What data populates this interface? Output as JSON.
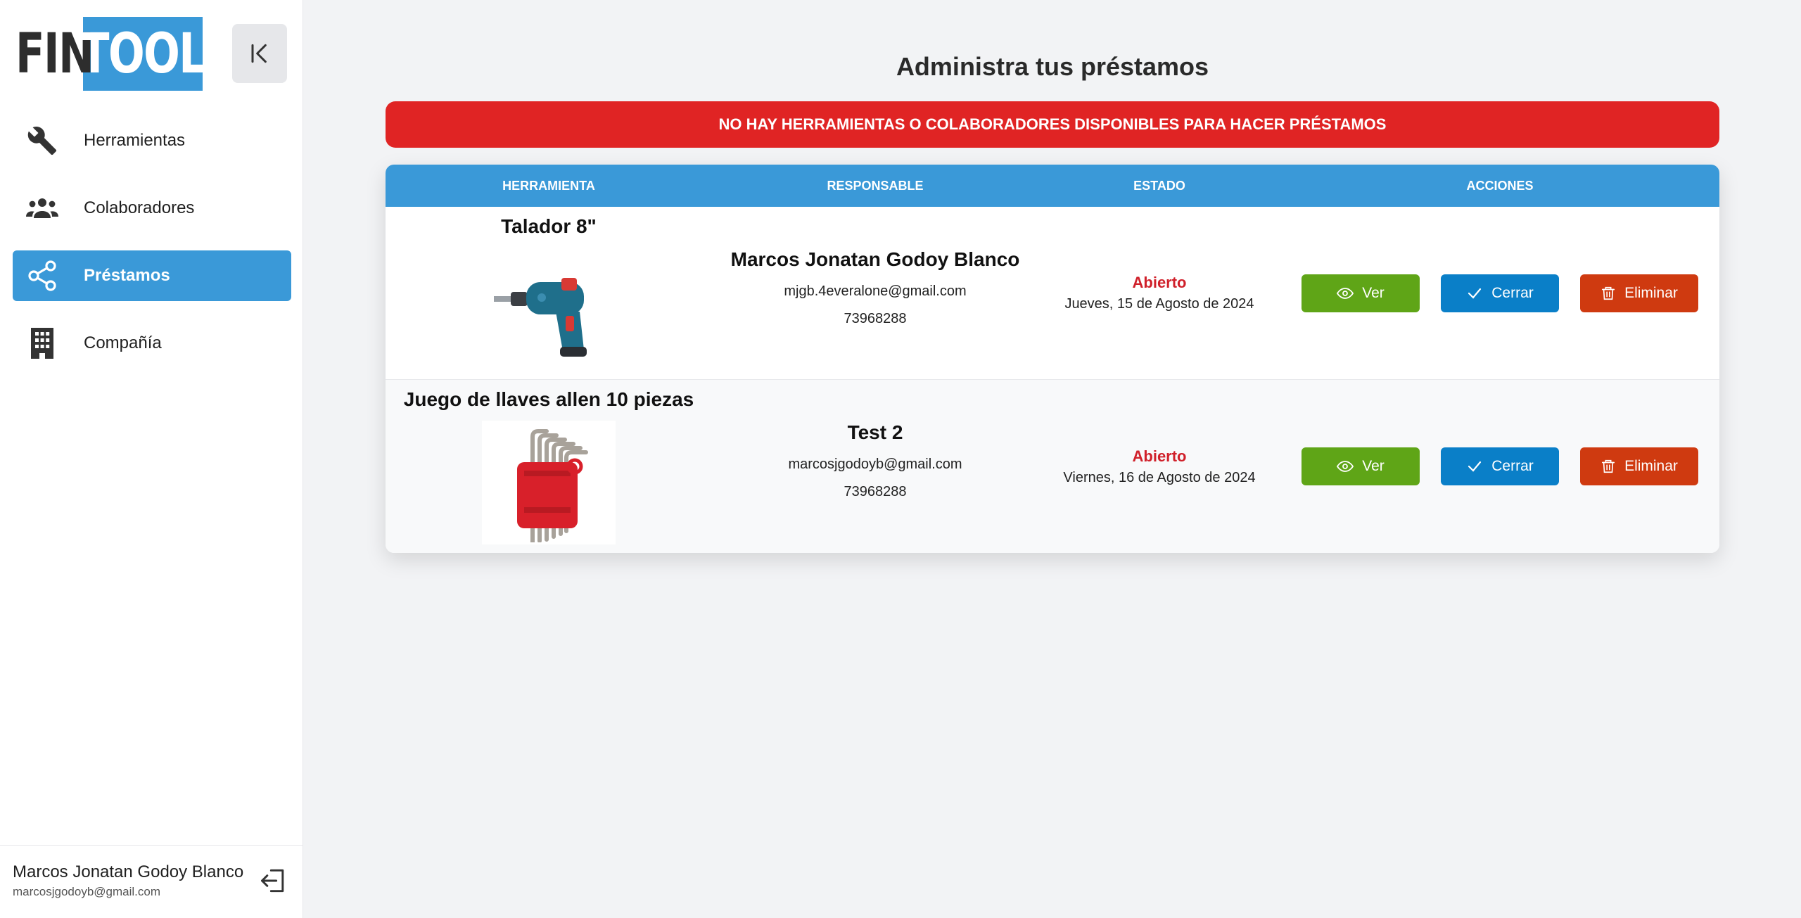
{
  "sidebar": {
    "logo": {
      "left": "FIN",
      "right": "TOOL"
    },
    "items": [
      {
        "label": "Herramientas",
        "icon": "wrench-icon"
      },
      {
        "label": "Colaboradores",
        "icon": "users-icon"
      },
      {
        "label": "Préstamos",
        "icon": "share-icon",
        "active": true
      },
      {
        "label": "Compañía",
        "icon": "building-icon"
      }
    ],
    "user": {
      "name": "Marcos Jonatan Godoy Blanco",
      "email": "marcosjgodoyb@gmail.com"
    }
  },
  "main": {
    "title": "Administra tus préstamos",
    "alert": "NO HAY HERRAMIENTAS O COLABORADORES DISPONIBLES PARA HACER PRÉSTAMOS",
    "table": {
      "headers": [
        "HERRAMIENTA",
        "RESPONSABLE",
        "ESTADO",
        "ACCIONES"
      ],
      "rows": [
        {
          "tool": "Talador 8\"",
          "responsible": "Marcos Jonatan Godoy Blanco",
          "email": "mjgb.4everalone@gmail.com",
          "phone": "73968288",
          "status": "Abierto",
          "date": "Jueves, 15 de Agosto de 2024"
        },
        {
          "tool": "Juego de llaves allen 10 piezas",
          "responsible": "Test 2",
          "email": "marcosjgodoyb@gmail.com",
          "phone": "73968288",
          "status": "Abierto",
          "date": "Viernes, 16 de Agosto de 2024"
        }
      ],
      "actions": {
        "view": "Ver",
        "close": "Cerrar",
        "delete": "Eliminar"
      }
    }
  },
  "colors": {
    "primary": "#3a99d8",
    "alert": "#e02424",
    "view": "#5fa517",
    "close": "#0a7fc8",
    "delete": "#cf3a10",
    "status_open": "#d0202a"
  }
}
